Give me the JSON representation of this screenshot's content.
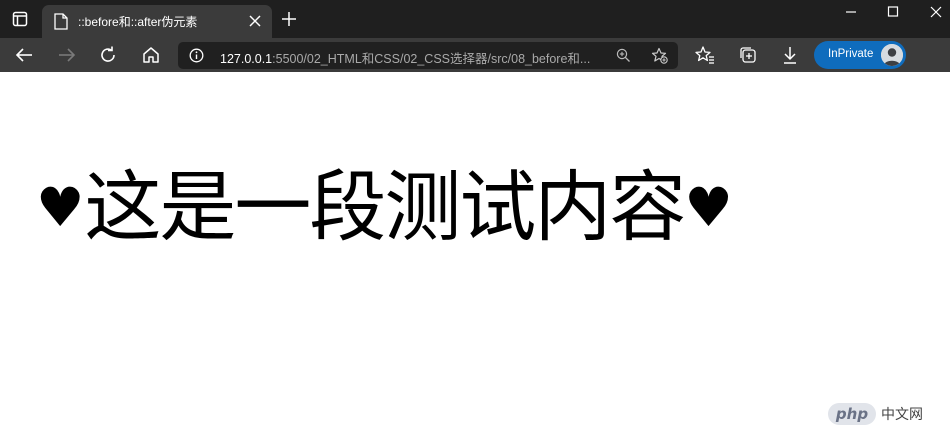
{
  "window": {
    "tab": {
      "title": "::before和::after伪元素"
    }
  },
  "toolbar": {
    "url_host": "127.0.0.1",
    "url_rest": ":5500/02_HTML和CSS/02_CSS选择器/src/08_before和...",
    "inprivate_label": "InPrivate"
  },
  "page": {
    "heart_before": "♥",
    "text": "这是一段测试内容",
    "heart_after": "♥"
  },
  "watermark": {
    "logo": "php",
    "text": "中文网"
  },
  "colors": {
    "titlebar": "#1f1f1f",
    "toolbar": "#3b3b3b",
    "urlbar": "#202020",
    "inprivate": "#0f6cbd"
  }
}
